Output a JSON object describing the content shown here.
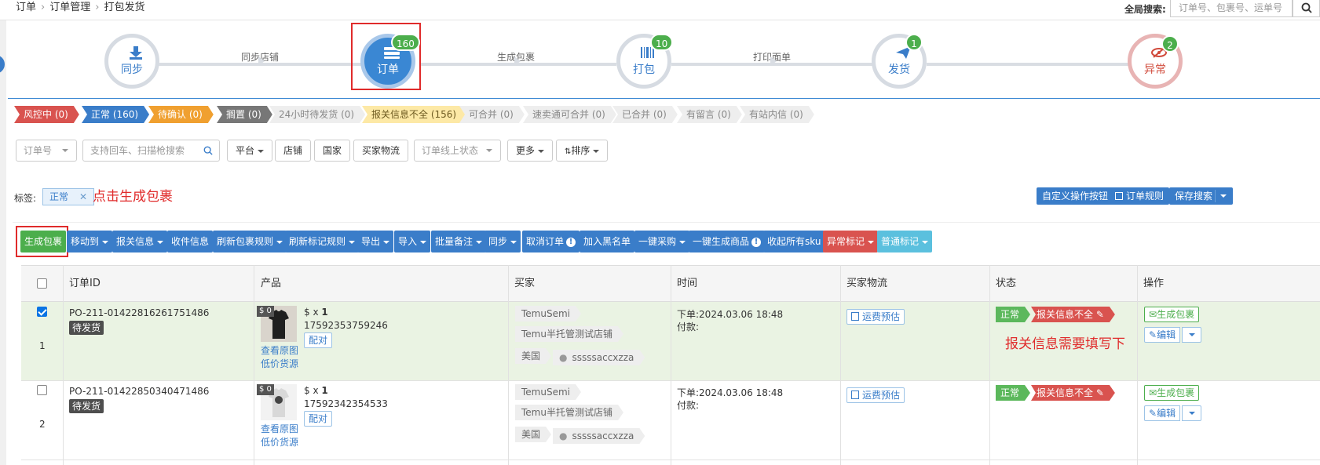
{
  "breadcrumb": [
    "订单",
    "订单管理",
    "打包发货"
  ],
  "global_search": {
    "label": "全局搜索:",
    "placeholder": "订单号、包裹号、运单号"
  },
  "workflow": {
    "steps": [
      {
        "label": "同步",
        "badge": ""
      },
      {
        "label": "订单",
        "badge": "160"
      },
      {
        "label": "打包",
        "badge": "10"
      },
      {
        "label": "发货",
        "badge": "1"
      },
      {
        "label": "异常",
        "badge": "2"
      }
    ],
    "connectors": [
      "同步店铺",
      "生成包裹",
      "打印面单"
    ]
  },
  "status_tabs": [
    {
      "label": "风控中 (0)",
      "bg": "#d9534f",
      "fg": "#ffffff"
    },
    {
      "label": "正常 (160)",
      "bg": "#3a7dc9",
      "fg": "#ffffff"
    },
    {
      "label": "待确认 (0)",
      "bg": "#f0a030",
      "fg": "#ffffff"
    },
    {
      "label": "搁置 (0)",
      "bg": "#777777",
      "fg": "#ffffff"
    },
    {
      "label": "24小时待发货 (0)",
      "bg": "#eeeeee",
      "fg": "#888888"
    },
    {
      "label": "报关信息不全 (156)",
      "bg": "#fde9a6",
      "fg": "#6d5a20"
    },
    {
      "label": "可合并 (0)",
      "bg": "#eeeeee",
      "fg": "#888888"
    },
    {
      "label": "速卖通可合并 (0)",
      "bg": "#eeeeee",
      "fg": "#888888"
    },
    {
      "label": "已合并 (0)",
      "bg": "#eeeeee",
      "fg": "#888888"
    },
    {
      "label": "有留言 (0)",
      "bg": "#eeeeee",
      "fg": "#888888"
    },
    {
      "label": "有站内信 (0)",
      "bg": "#eeeeee",
      "fg": "#888888"
    }
  ],
  "filters": {
    "order_no": "订单号",
    "scan_placeholder": "支持回车、扫描枪搜索",
    "platform": "平台",
    "store": "店铺",
    "country": "国家",
    "buyer_logistics": "买家物流",
    "online_status": "订单线上状态",
    "more": "更多",
    "sort": "排序"
  },
  "tags": {
    "label": "标签:",
    "chip": "正常"
  },
  "annotations": {
    "click_generate": "点击生成包裹",
    "customs_note": "报关信息需要填写下"
  },
  "right_buttons": {
    "custom_ops": "自定义操作按钮",
    "order_rules": "订单规则",
    "save_search": "保存搜索"
  },
  "actions": [
    "生成包裹",
    "移动到",
    "报关信息",
    "收件信息",
    "刷新包裹规则",
    "刷新标记规则",
    "导出",
    "导入",
    "批量备注",
    "同步",
    "取消订单",
    "加入黑名单",
    "一键采购",
    "一键生成商品",
    "收起所有sku",
    "异常标记",
    "普通标记"
  ],
  "table": {
    "headers": [
      "订单ID",
      "产品",
      "买家",
      "时间",
      "买家物流",
      "状态",
      "操作"
    ],
    "rows": [
      {
        "index": "1",
        "checked": true,
        "order_id": "PO-211-01422816261751486",
        "status_badge": "待发货",
        "price_tag": "$ 0",
        "qty": "$ x",
        "qty_num": "1",
        "sku": "17592353759246",
        "view_image": "查看原图",
        "low_price": "低价货源",
        "pair": "配对",
        "buyer": [
          "TemuSemi",
          "Temu半托管测试店铺",
          "美国",
          "sssssaccxzza"
        ],
        "time_order": "下单:2024.03.06 18:48",
        "time_pay": "付款:",
        "freight": "运费预估",
        "st_normal": "正常",
        "st_customs": "报关信息不全",
        "op_generate": "生成包裹",
        "op_edit": "编辑"
      },
      {
        "index": "2",
        "checked": false,
        "order_id": "PO-211-01422850340471486",
        "status_badge": "待发货",
        "price_tag": "$ 0",
        "qty": "$ x",
        "qty_num": "1",
        "sku": "17592342354533",
        "view_image": "查看原图",
        "low_price": "低价货源",
        "pair": "配对",
        "buyer": [
          "TemuSemi",
          "Temu半托管测试店铺",
          "美国",
          "sssssaccxzza"
        ],
        "time_order": "下单:2024.03.06 18:48",
        "time_pay": "付款:",
        "freight": "运费预估",
        "st_normal": "正常",
        "st_customs": "报关信息不全",
        "op_generate": "生成包裹",
        "op_edit": "编辑"
      }
    ]
  }
}
